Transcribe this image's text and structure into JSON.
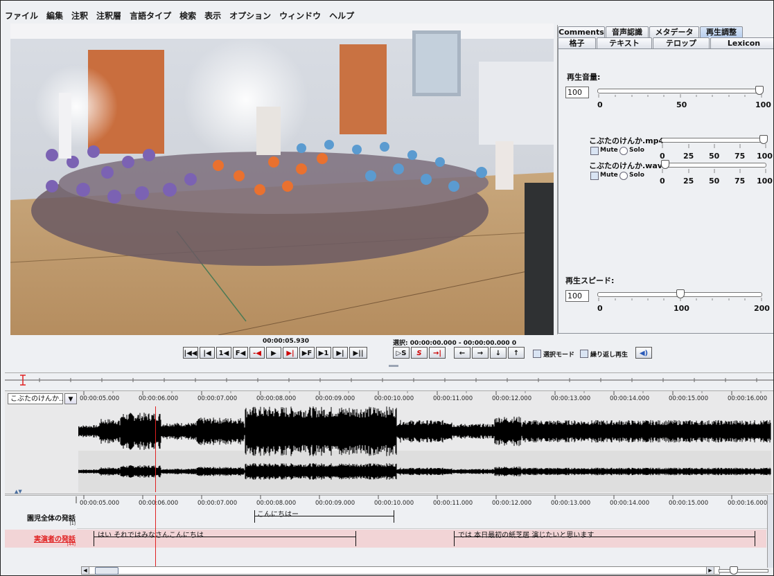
{
  "menu": [
    "ファイル",
    "編集",
    "注釈",
    "注釈層",
    "言語タイプ",
    "検索",
    "表示",
    "オプション",
    "ウィンドウ",
    "ヘルプ"
  ],
  "tabs_row1": [
    {
      "label": "Comments",
      "active": false
    },
    {
      "label": "音声認識",
      "active": false
    },
    {
      "label": "メタデータ",
      "active": false
    },
    {
      "label": "再生調整",
      "active": true
    }
  ],
  "tabs_row2": [
    "格子",
    "テキスト",
    "テロップ",
    "Lexicon"
  ],
  "volume": {
    "label": "再生音量:",
    "value": "100",
    "level": 1.0,
    "scale": [
      "0",
      "50",
      "100"
    ]
  },
  "tracks": [
    {
      "name": "こぶたのけんか.mp4",
      "mute": "Mute",
      "solo": "Solo",
      "level": 1.0,
      "scale": [
        "0",
        "25",
        "50",
        "75",
        "100"
      ]
    },
    {
      "name": "こぶたのけんか.wav",
      "mute": "Mute",
      "solo": "Solo",
      "level": 0.0,
      "scale": [
        "0",
        "25",
        "50",
        "75",
        "100"
      ]
    }
  ],
  "speed": {
    "label": "再生スピード:",
    "value": "100",
    "level": 0.5,
    "scale": [
      "0",
      "100",
      "200"
    ]
  },
  "transport": {
    "current_time": "00:00:05.930",
    "selection": "選択: 00:00:00.000 - 00:00:00.000  0",
    "selection_mode": "選択モード",
    "loop_play": "繰り返し再生",
    "buttons": [
      "|◀◀",
      "|◀",
      "1◀",
      "F◀",
      "-◀",
      "▶",
      "▶|",
      "▶F",
      "▶1",
      "▶|",
      "▶||"
    ],
    "sel_buttons": [
      "▷S",
      "S",
      "→|"
    ],
    "arrow_buttons": [
      "←",
      "→",
      "↓",
      "↑"
    ]
  },
  "waveform": {
    "selector": "こぶたのけんか....",
    "time_labels": [
      "00:00:05.000",
      "00:00:06.000",
      "00:00:07.000",
      "00:00:08.000",
      "00:00:09.000",
      "00:00:10.000",
      "00:00:11.000",
      "00:00:12.000",
      "00:00:13.000",
      "00:00:14.000",
      "00:00:15.000",
      "00:00:16.000"
    ]
  },
  "tiers": [
    {
      "name": "園児全体の発話",
      "count": "[1]",
      "highlight": false,
      "annotations": [
        {
          "text": "こんにちはー"
        }
      ]
    },
    {
      "name": "実演者の発話",
      "count": "[44]",
      "highlight": true,
      "annotations": [
        {
          "text": "はい それではみなさんこんにちは"
        },
        {
          "text": "では 本日最初の紙芝居 演じたいと思います"
        }
      ]
    }
  ],
  "colors": {
    "accent": "#e02020",
    "tier_highlight": "#f2d4d6",
    "tab_active": "#b9cfee"
  }
}
